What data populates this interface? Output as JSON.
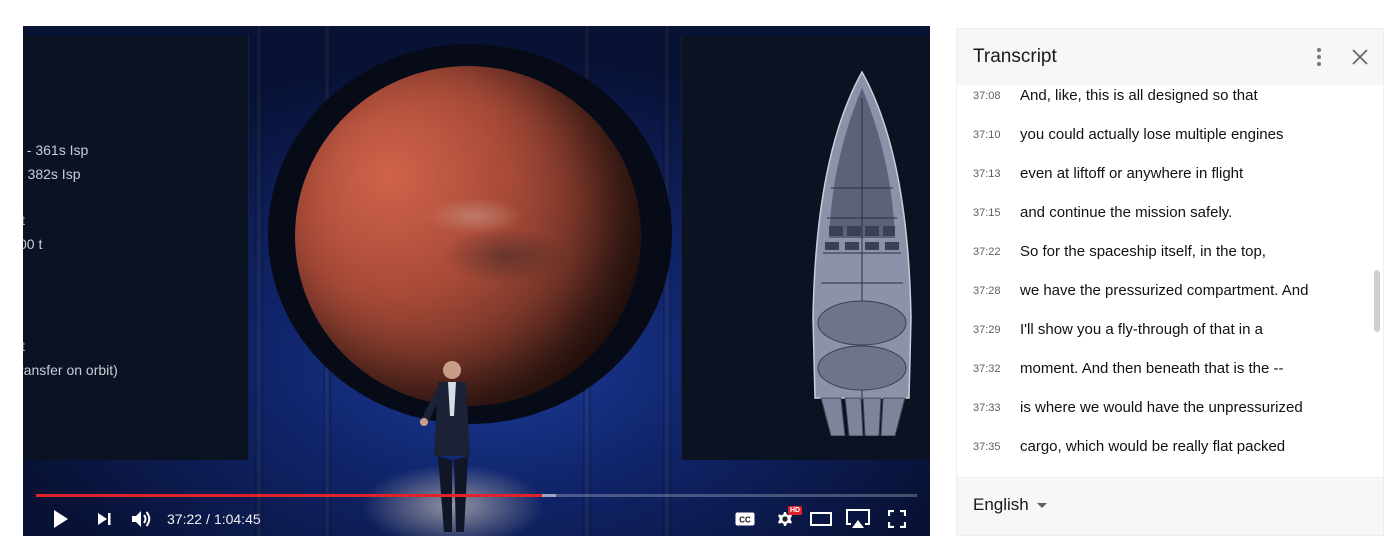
{
  "video": {
    "slide_text": [
      "t - 361s Isp",
      "- 382s Isp",
      "t",
      "00 t",
      "t",
      "ransfer on orbit)"
    ],
    "progress_fraction": 0.5746,
    "loaded_fraction": 0.59,
    "current_time": "37:22",
    "time_separator": "/",
    "duration": "1:04:45",
    "hd_badge": "HD",
    "controls": [
      "play-icon",
      "next-icon",
      "volume-icon",
      "captions-icon",
      "settings-icon",
      "theater-icon",
      "airplay-icon",
      "fullscreen-icon"
    ],
    "accent_color": "#e0232a"
  },
  "transcript": {
    "title": "Transcript",
    "lines": [
      {
        "time": "37:08",
        "text": "And, like, this is all designed so that"
      },
      {
        "time": "37:10",
        "text": "you could actually lose multiple engines"
      },
      {
        "time": "37:13",
        "text": "even at liftoff or anywhere in flight"
      },
      {
        "time": "37:15",
        "text": "and continue the mission safely."
      },
      {
        "time": "37:22",
        "text": "So for the spaceship itself, in the top,"
      },
      {
        "time": "37:28",
        "text": "we have the pressurized compartment. And"
      },
      {
        "time": "37:29",
        "text": "I'll show you a fly-through of that in a"
      },
      {
        "time": "37:32",
        "text": "moment. And then beneath that is the --"
      },
      {
        "time": "37:33",
        "text": "is where we would have the unpressurized"
      },
      {
        "time": "37:35",
        "text": "cargo, which would be really flat packed"
      }
    ],
    "language": "English"
  }
}
